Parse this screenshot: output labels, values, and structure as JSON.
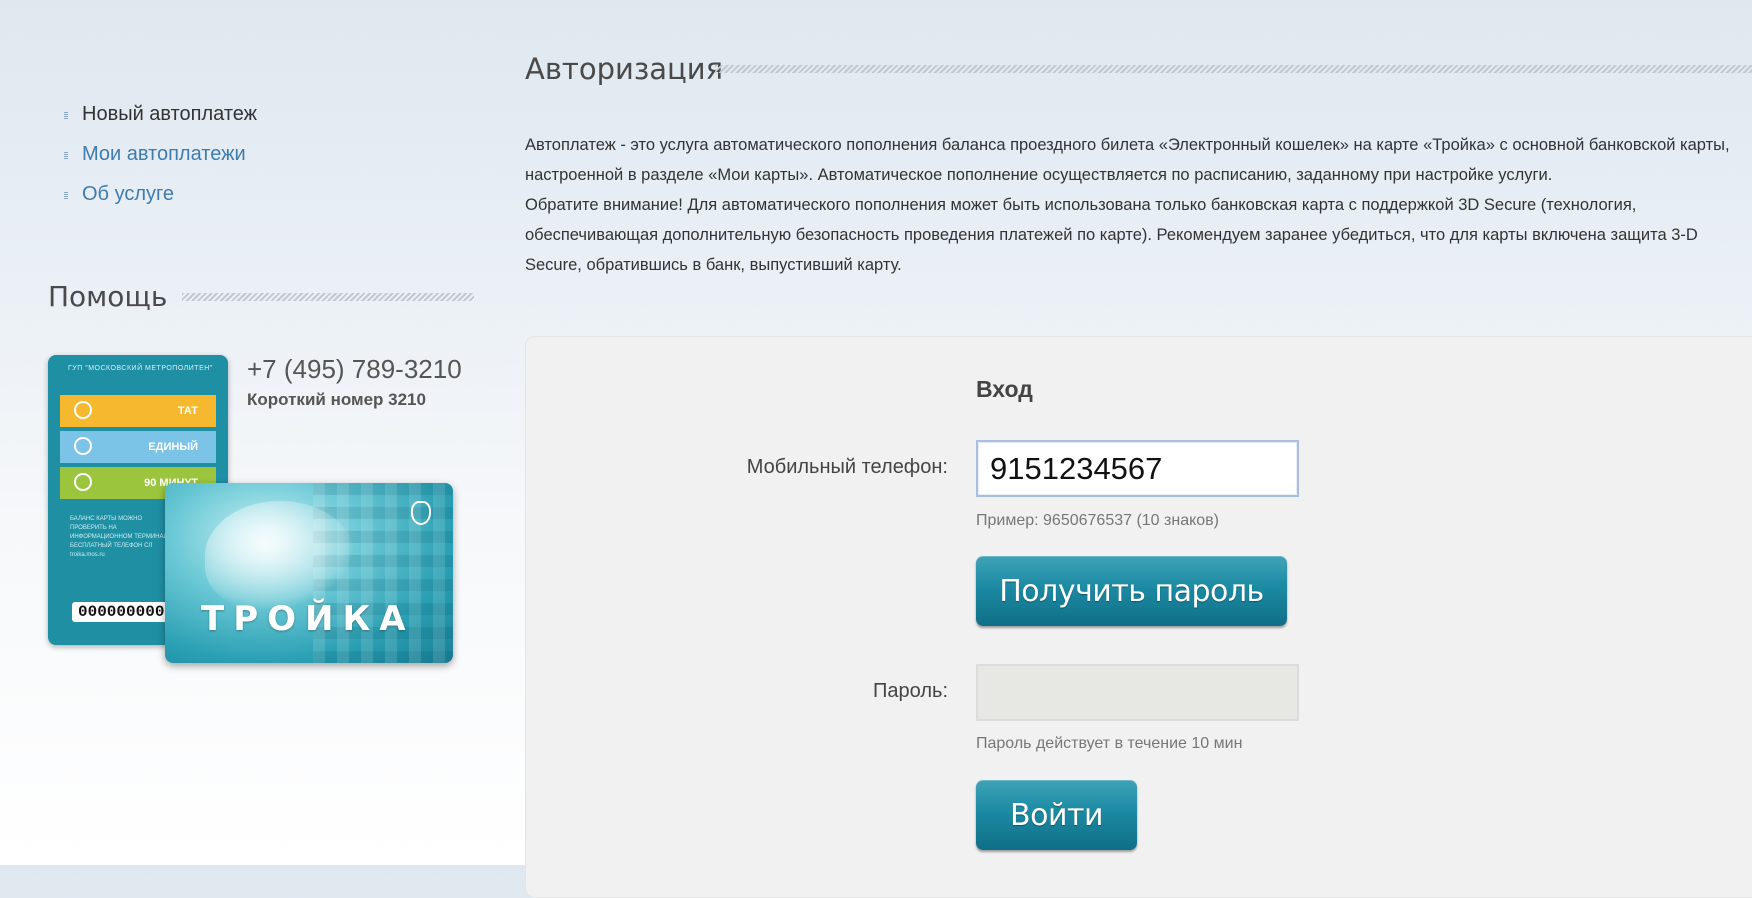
{
  "sidebar": {
    "items": [
      {
        "label": "Новый автоплатеж"
      },
      {
        "label": "Мои автоплатежи"
      },
      {
        "label": "Об услуге"
      }
    ]
  },
  "help": {
    "title": "Помощь",
    "phone": "+7 (495) 789-3210",
    "short_number": "Короткий номер 3210",
    "card": {
      "org": "ГУП \"МОСКОВСКИЙ МЕТРОПОЛИТЕН\"",
      "band_tat": "ТАТ",
      "band_unified": "ЕДИНЫЙ",
      "band_90": "90 МИНУТ",
      "back_text": "БАЛАНС КАРТЫ МОЖНО ПРОВЕРИТЬ НА ИНФОРМАЦИОННОМ ТЕРМИНАЛЕ БЕСПЛАТНЫЙ ТЕЛЕФОН СЛ troika.mos.ru",
      "number": "000000000",
      "brand": "ТРОЙКА"
    }
  },
  "main": {
    "title": "Авторизация",
    "description": [
      "Автоплатеж - это услуга автоматического пополнения баланса проездного билета «Электронный кошелек» на карте «Тройка» с основной банковской карты, настроенной в разделе «Мои карты». Автоматическое пополнение осуществляется по расписанию, заданному при настройке услуги.",
      "Обратите внимание! Для автоматического пополнения может быть использована только банковская карта с поддержкой 3D Secure (технология, обеспечивающая дополнительную безопасность проведения платежей по карте). Рекомендуем заранее убедиться, что для карты включена защита 3-D Secure, обратившись в банк, выпустивший карту."
    ],
    "form": {
      "title": "Вход",
      "phone_label": "Мобильный телефон:",
      "phone_value": "9151234567",
      "phone_hint": "Пример: 9650676537 (10 знаков)",
      "get_password_button": "Получить пароль",
      "password_label": "Пароль:",
      "password_value": "",
      "password_hint": "Пароль действует в течение 10 мин",
      "login_button": "Войти"
    }
  },
  "colors": {
    "link": "#3f7cad",
    "button": "#1c8aa3",
    "background": "#e9eff5"
  }
}
